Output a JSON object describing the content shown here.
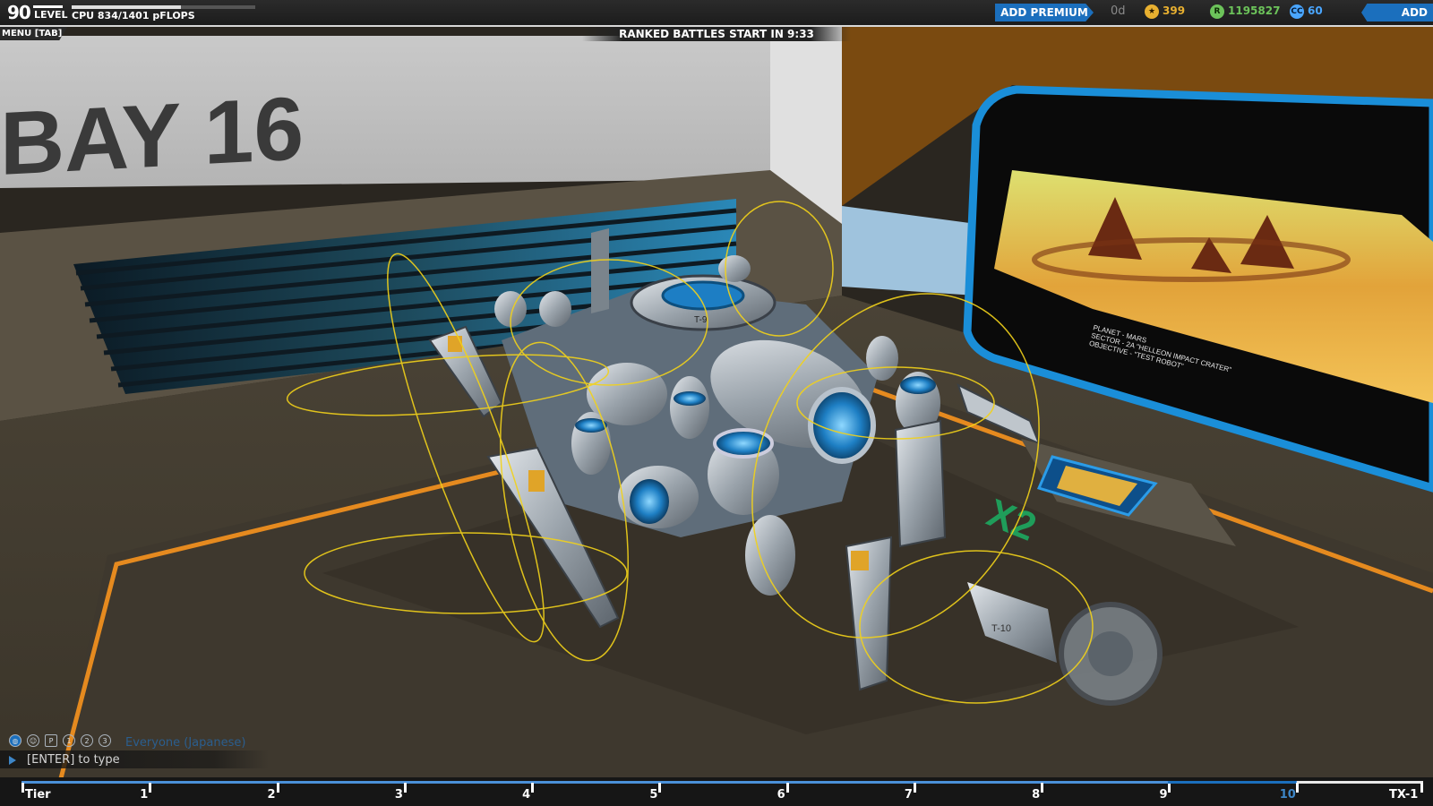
{
  "hud": {
    "level_value": "90",
    "level_label": "LEVEL",
    "cpu_label": "CPU 834/1401 pFLOPS",
    "cpu_used": 834,
    "cpu_max": 1401,
    "premium_button": "ADD PREMIUM",
    "premium_days": "0d",
    "currencies": [
      {
        "icon": "star-icon",
        "value": "399",
        "color": "#e8b030"
      },
      {
        "icon": "robits-icon",
        "value": "1195827",
        "color": "#6cc35a"
      },
      {
        "icon": "cosmetic-credits-icon",
        "value": "60",
        "color": "#4aa6ff"
      }
    ],
    "funds_button": "ADD FUNDS",
    "menu_tab": "MENU [TAB]",
    "ranked_banner": "RANKED BATTLES START IN 9:33"
  },
  "scene": {
    "bay_label": "BAY 16",
    "multiplier": "X2",
    "robot_top_label": "T-9",
    "robot_side_label": "T-10",
    "screen_lines": [
      "PLANET - MARS",
      "SECTOR - 2A \"HELLEON IMPACT CRATER\"",
      "OBJECTIVE - \"TEST ROBOT\""
    ]
  },
  "chat": {
    "channel_icons": [
      "globe-icon",
      "person-icon",
      "p-badge-icon",
      "party-1-icon",
      "party-2-icon",
      "party-3-icon"
    ],
    "channel": "Everyone (Japanese)",
    "input_hint": "[ENTER] to type"
  },
  "tier_bar": {
    "labels": [
      "Tier",
      "1",
      "2",
      "3",
      "4",
      "5",
      "6",
      "7",
      "8",
      "9",
      "10",
      "TX-1"
    ],
    "highlighted": "10",
    "progress": 0.91
  },
  "colors": {
    "accent_blue": "#1b6fbd",
    "orange_trim": "#e58a1f",
    "gizmo_yellow": "#f2d21a"
  }
}
